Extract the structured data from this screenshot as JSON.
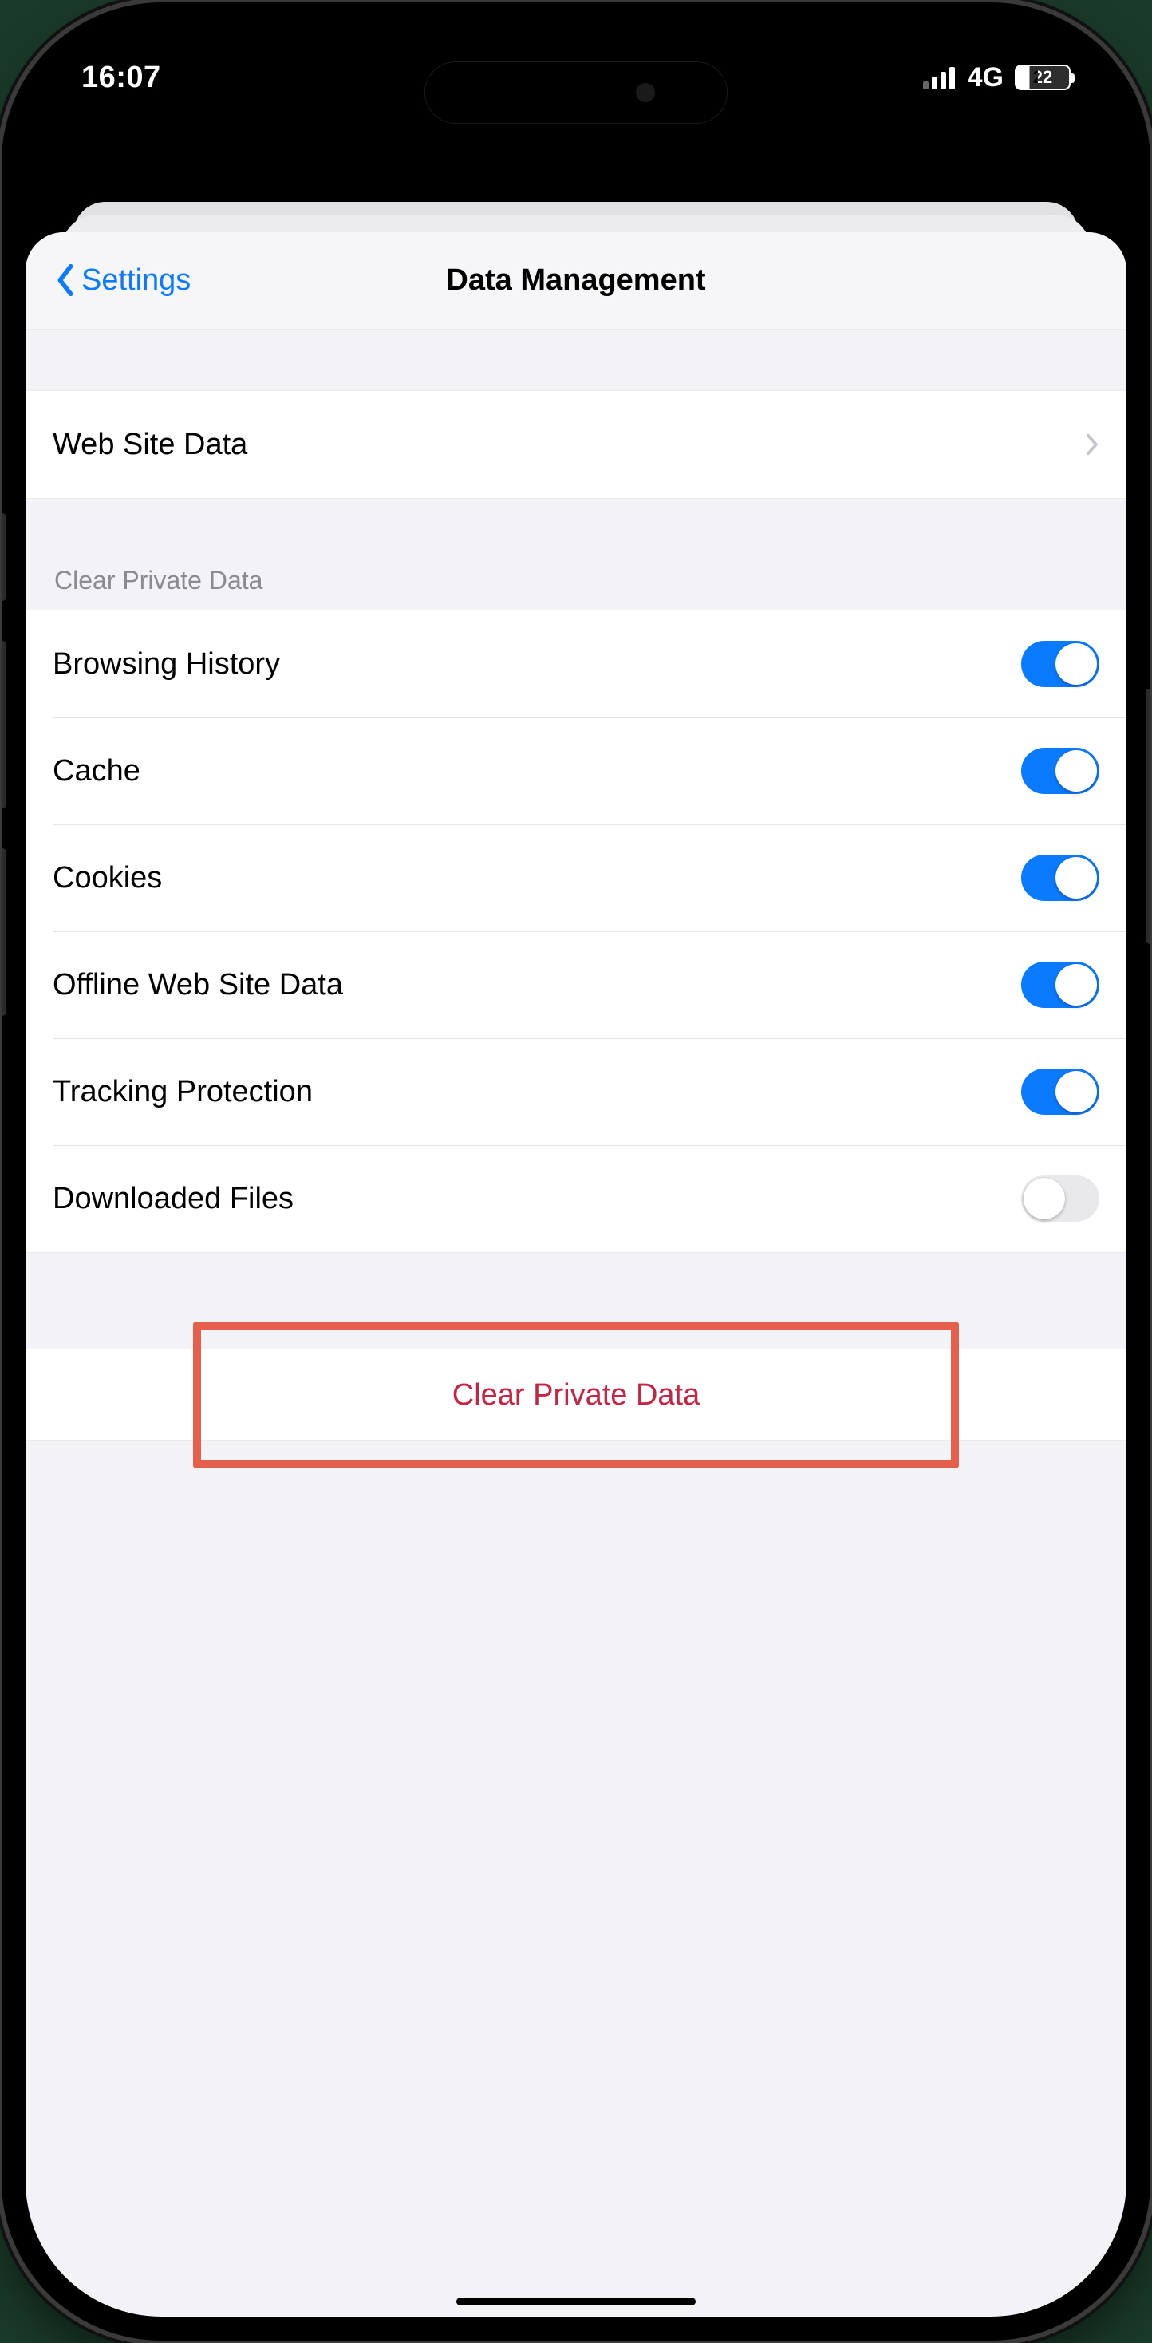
{
  "status": {
    "time": "16:07",
    "network": "4G",
    "battery_pct": "22"
  },
  "nav": {
    "back_label": "Settings",
    "title": "Data Management"
  },
  "sections": {
    "web_site_data": {
      "label": "Web Site Data"
    },
    "clear_private_header": "Clear Private Data",
    "toggles": [
      {
        "label": "Browsing History",
        "on": true
      },
      {
        "label": "Cache",
        "on": true
      },
      {
        "label": "Cookies",
        "on": true
      },
      {
        "label": "Offline Web Site Data",
        "on": true
      },
      {
        "label": "Tracking Protection",
        "on": true
      },
      {
        "label": "Downloaded Files",
        "on": false
      }
    ],
    "clear_button": "Clear Private Data"
  },
  "colors": {
    "accent_blue": "#0a7aff",
    "destructive": "#c52443",
    "highlight_border": "#e4604d"
  }
}
